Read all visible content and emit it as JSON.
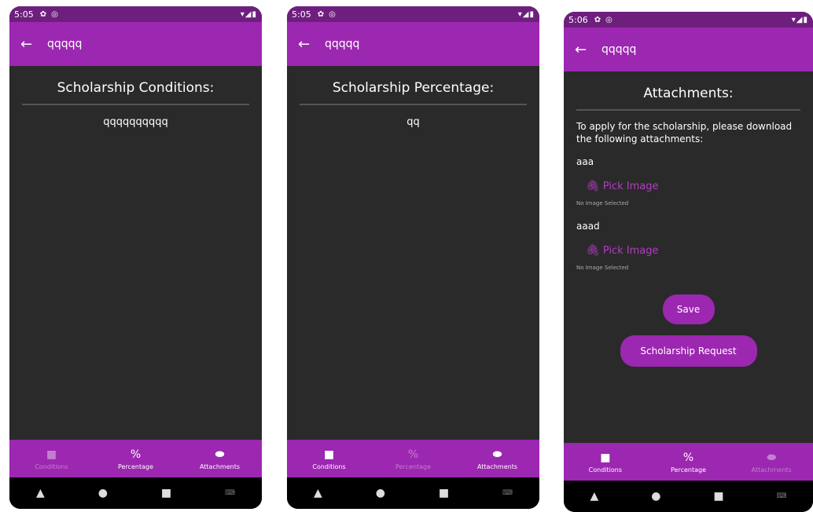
{
  "phones": [
    {
      "status": {
        "time": "5:05",
        "right": "▾◢▮"
      },
      "appbar": {
        "back": "←",
        "title": "qqqqq"
      },
      "heading": "Scholarship Conditions:",
      "value": "qqqqqqqqqq",
      "nav": [
        "Conditions",
        "Percentage",
        "Attachments"
      ]
    },
    {
      "status": {
        "time": "5:05",
        "right": "▾◢▮"
      },
      "appbar": {
        "back": "←",
        "title": "qqqqq"
      },
      "heading": "Scholarship Percentage:",
      "value": "qq",
      "nav": [
        "Conditions",
        "Percentage",
        "Attachments"
      ]
    },
    {
      "status": {
        "time": "5:06",
        "right": "▾◢▮"
      },
      "appbar": {
        "back": "←",
        "title": "qqqqq"
      },
      "heading": "Attachments:",
      "instructions": "To apply for the scholarship, please download the following attachments:",
      "attachments": [
        {
          "name": "aaa",
          "pick_label": "Pick Image",
          "status": "No Image Selected"
        },
        {
          "name": "aaad",
          "pick_label": "Pick Image",
          "status": "No Image Selected"
        }
      ],
      "save_label": "Save",
      "request_label": "Scholarship Request",
      "nav": [
        "Conditions",
        "Percentage",
        "Attachments"
      ]
    }
  ],
  "icons": {
    "conditions": "folder-icon",
    "percentage": "percent-icon",
    "attachments": "toggle-icon"
  },
  "colors": {
    "primary": "#9c27b0",
    "status": "#6e1f7e",
    "background": "#2a2a2a",
    "inactive": "#c47ed1"
  }
}
